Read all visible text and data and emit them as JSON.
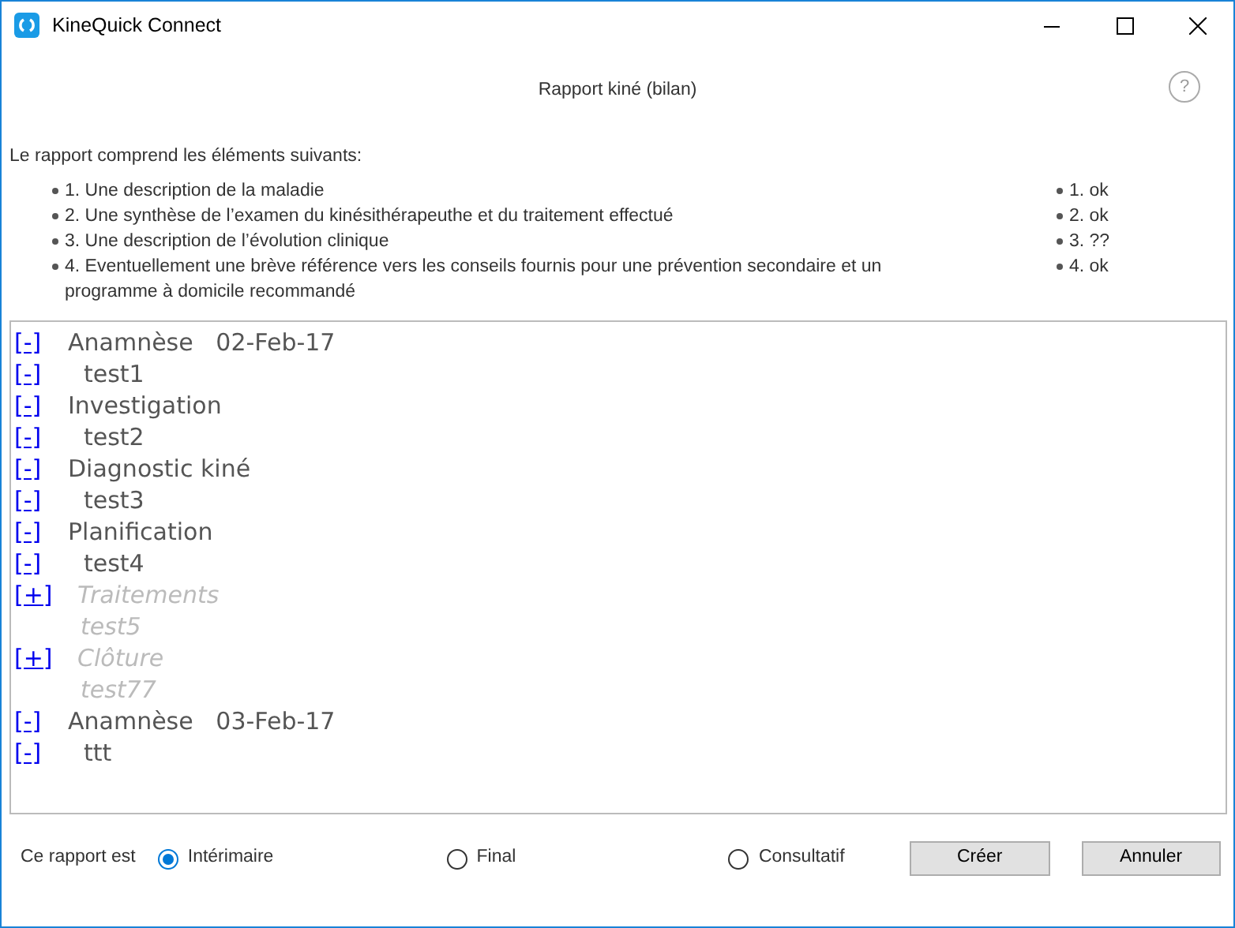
{
  "window": {
    "title": "KineQuick Connect"
  },
  "dialog": {
    "title": "Rapport kiné (bilan)",
    "help": "?"
  },
  "intro": "Le rapport comprend les éléments suivants:",
  "requirements": [
    {
      "text": "1. Une description de la maladie",
      "status": "1. ok"
    },
    {
      "text": "2. Une synthèse de l’examen du kinésithérapeuthe et du traitement effectué",
      "status": "2. ok"
    },
    {
      "text": "3. Une description de l’évolution clinique",
      "status": "3. ??"
    },
    {
      "text": "4. Eventuellement une brève référence vers les conseils fournis pour une prévention secondaire et un programme à domicile recommandé",
      "status": "4. ok"
    }
  ],
  "tree": [
    {
      "toggle": "[-]",
      "label": "Anamnèse   02-Feb-17",
      "disabled": false,
      "children": [
        {
          "toggle": "[-]",
          "label": "test1",
          "disabled": false
        }
      ]
    },
    {
      "toggle": "[-]",
      "label": "Investigation",
      "disabled": false,
      "children": [
        {
          "toggle": "[-]",
          "label": "test2",
          "disabled": false
        }
      ]
    },
    {
      "toggle": "[-]",
      "label": "Diagnostic kiné",
      "disabled": false,
      "children": [
        {
          "toggle": "[-]",
          "label": "test3",
          "disabled": false
        }
      ]
    },
    {
      "toggle": "[-]",
      "label": "Planification",
      "disabled": false,
      "children": [
        {
          "toggle": "[-]",
          "label": "test4",
          "disabled": false
        }
      ]
    },
    {
      "toggle": "[+]",
      "label": "Traitements",
      "disabled": true,
      "children": [
        {
          "label": "test5",
          "disabled": true
        }
      ]
    },
    {
      "toggle": "[+]",
      "label": "Clôture",
      "disabled": true,
      "children": [
        {
          "label": "test77",
          "disabled": true
        }
      ]
    },
    {
      "toggle": "[-]",
      "label": "Anamnèse   03-Feb-17",
      "disabled": false,
      "children": [
        {
          "toggle": "[-]",
          "label": "ttt",
          "disabled": false
        }
      ]
    }
  ],
  "report_type": {
    "label": "Ce rapport est",
    "options": [
      {
        "label": "Intérimaire",
        "selected": true
      },
      {
        "label": "Final",
        "selected": false
      },
      {
        "label": "Consultatif",
        "selected": false
      }
    ]
  },
  "buttons": [
    "Créer",
    "Annuler"
  ]
}
